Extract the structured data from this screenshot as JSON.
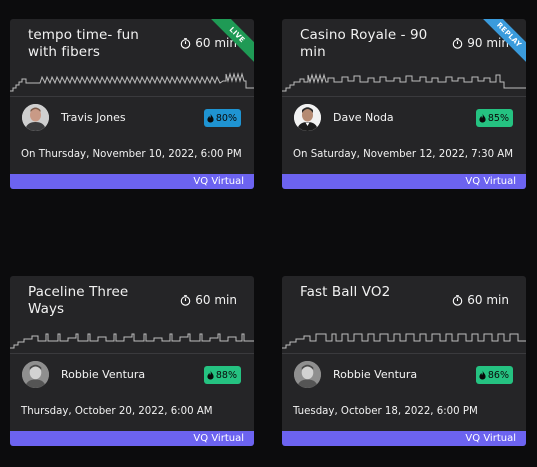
{
  "cards": [
    {
      "title": "tempo time- fun with fibers",
      "duration": "60 min",
      "ribbon": "LIVE",
      "instructor": "Travis Jones",
      "match": "80%",
      "date": "On Thursday, November 10, 2022, 6:00 PM",
      "footer": "VQ Virtual"
    },
    {
      "title": "Casino Royale - 90 min",
      "duration": "90 min",
      "ribbon": "REPLAY",
      "instructor": "Dave Noda",
      "match": "85%",
      "date": "On Saturday, November 12, 2022, 7:30 AM",
      "footer": "VQ Virtual"
    },
    {
      "title": "Paceline Three Ways",
      "duration": "60 min",
      "instructor": "Robbie Ventura",
      "match": "88%",
      "date": "Thursday, October 20, 2022, 6:00 AM",
      "footer": "VQ Virtual"
    },
    {
      "title": "Fast Ball VO2",
      "duration": "60 min",
      "instructor": "Robbie Ventura",
      "match": "86%",
      "date": "Tuesday, October 18, 2022, 6:00 PM",
      "footer": "VQ Virtual"
    }
  ],
  "colors": {
    "background": "#0c0c0d",
    "card": "#252527",
    "footer": "#6c63f0",
    "live_ribbon": "#1f9a55",
    "replay_ribbon": "#3a9bdc",
    "match_blue": "#1f94d2",
    "match_green": "#25c281"
  },
  "icons": [
    "timer-icon",
    "flame-icon",
    "avatar"
  ]
}
